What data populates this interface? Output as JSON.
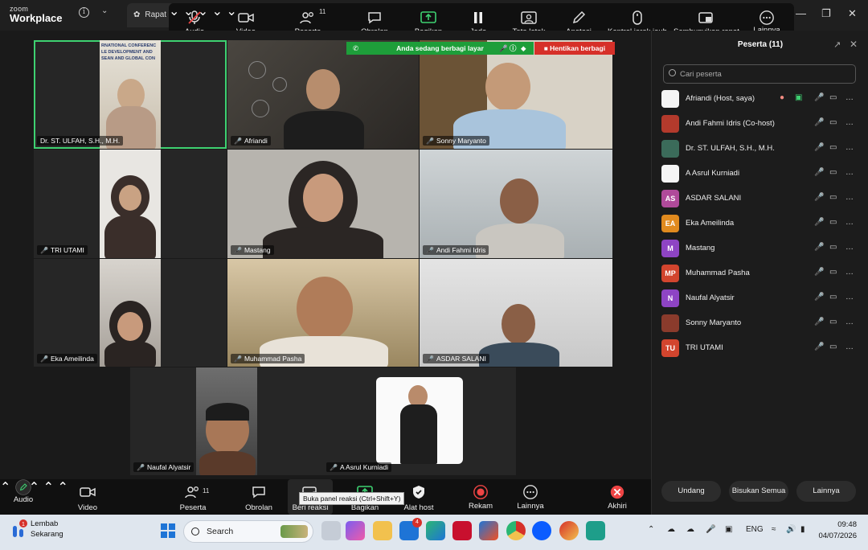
{
  "app": {
    "brand_top": "zoom",
    "brand_bottom": "Workplace",
    "meeting_tab": "Rapat"
  },
  "floatbar": {
    "audio": "Audio",
    "video": "Video",
    "participants": "Peserta",
    "participants_count": "11",
    "chat": "Obrolan",
    "share": "Bagikan",
    "pause": "Jeda",
    "layout": "Tata letak",
    "annotate": "Anotasi",
    "remote_control": "Kontrol jarak jauh",
    "hide_meeting": "Sembunyikan rapat",
    "more": "Lainnya"
  },
  "share_banner": {
    "status": "Anda sedang berbagi layar",
    "stop": "Hentikan berbagi"
  },
  "tiles": [
    {
      "name": "Dr. ST. ULFAH, S.H., M.H."
    },
    {
      "name": "Afriandi"
    },
    {
      "name": "Sonny Maryanto"
    },
    {
      "name": "TRI UTAMI"
    },
    {
      "name": "Mastang"
    },
    {
      "name": "Andi Fahmi Idris"
    },
    {
      "name": "Eka Ameilinda"
    },
    {
      "name": "Muhammad Pasha"
    },
    {
      "name": "ASDAR SALANI"
    },
    {
      "name": "Naufal Alyatsir"
    },
    {
      "name": "A Asrul Kurniadi"
    }
  ],
  "slide_text": [
    "RNATIONAL CONFERENC",
    "LE DEVELOPMENT AND",
    "SEAN AND GLOBAL CON"
  ],
  "panel": {
    "title": "Peserta (11)",
    "search_placeholder": "Cari peserta",
    "participants": [
      {
        "name": "Afriandi (Host, saya)",
        "initials": "",
        "color": "#f5f5f5"
      },
      {
        "name": "Andi Fahmi Idris (Co-host)",
        "initials": "",
        "color": "#b33a2c"
      },
      {
        "name": "Dr. ST. ULFAH, S.H., M.H.",
        "initials": "",
        "color": "#3b6b5a"
      },
      {
        "name": "A Asrul Kurniadi",
        "initials": "",
        "color": "#f5f5f5"
      },
      {
        "name": "ASDAR SALANI",
        "initials": "AS",
        "color": "#b04a9a"
      },
      {
        "name": "Eka Ameilinda",
        "initials": "EA",
        "color": "#e08a1e"
      },
      {
        "name": "Mastang",
        "initials": "M",
        "color": "#8e44c4"
      },
      {
        "name": "Muhammad Pasha",
        "initials": "MP",
        "color": "#d2452e"
      },
      {
        "name": "Naufal Alyatsir",
        "initials": "N",
        "color": "#8e44c4"
      },
      {
        "name": "Sonny Maryanto",
        "initials": "",
        "color": "#8a3b2c"
      },
      {
        "name": "TRI UTAMI",
        "initials": "TU",
        "color": "#d2452e"
      }
    ],
    "invite": "Undang",
    "mute_all": "Bisukan Semua",
    "more": "Lainnya"
  },
  "bottombar": {
    "audio": "Audio",
    "video": "Video",
    "participants": "Peserta",
    "participants_count": "11",
    "chat": "Obrolan",
    "reactions": "Beri reaksi",
    "share": "Bagikan",
    "host_tools": "Alat host",
    "record": "Rekam",
    "more": "Lainnya",
    "end": "Akhiri",
    "tooltip": "Buka panel reaksi (Ctrl+Shift+Y)"
  },
  "taskbar": {
    "weather_title": "Lembab",
    "weather_sub": "Sekarang",
    "weather_badge": "1",
    "search": "Search",
    "lang": "ENG",
    "time": "09:48",
    "date": "04/07/2026",
    "mail_badge": "4"
  },
  "colors": {
    "accent_green": "#1e9e3a",
    "stop_red": "#d63029",
    "active_border": "#3ed171"
  }
}
